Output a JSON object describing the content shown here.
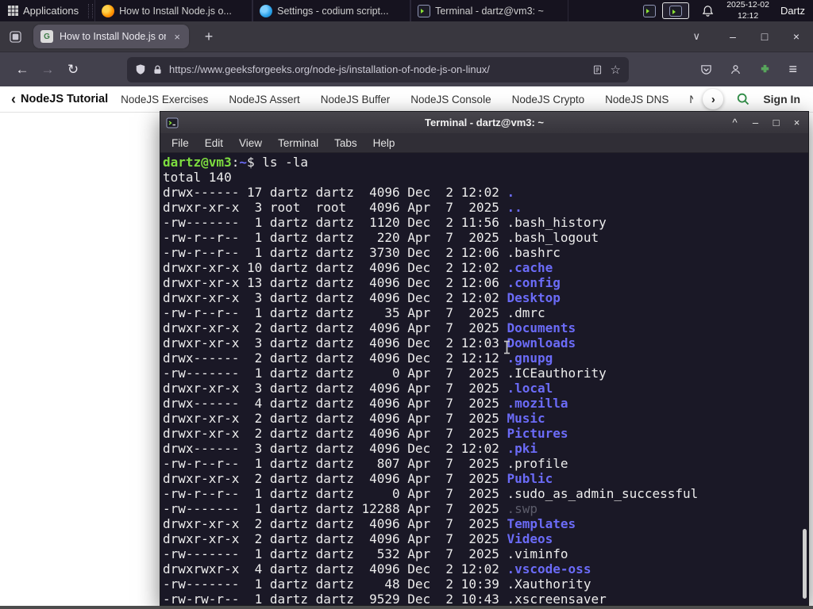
{
  "taskbar": {
    "applications_label": "Applications",
    "windows": [
      {
        "icon": "firefox",
        "label": "How to Install Node.js o..."
      },
      {
        "icon": "codium",
        "label": "Settings - codium script..."
      },
      {
        "icon": "terminal",
        "label": "Terminal - dartz@vm3: ~"
      }
    ],
    "clock_date": "2025-12-02",
    "clock_time": "12:12",
    "user_label": "Dartz"
  },
  "browser": {
    "tab_title": "How to Install Node.js on",
    "url": "https://www.geeksforgeeks.org/node-js/installation-of-node-js-on-linux/",
    "site_nav": {
      "title": "NodeJS Tutorial",
      "items": [
        "NodeJS Exercises",
        "NodeJS Assert",
        "NodeJS Buffer",
        "NodeJS Console",
        "NodeJS Crypto",
        "NodeJS DNS",
        "Node..."
      ],
      "sign_in_label": "Sign In"
    }
  },
  "terminal": {
    "title": "Terminal - dartz@vm3: ~",
    "menu": [
      "File",
      "Edit",
      "View",
      "Terminal",
      "Tabs",
      "Help"
    ],
    "prompt": {
      "user_host": "dartz@vm3",
      "colon": ":",
      "path": "~",
      "dollar": "$",
      "command": " ls -la"
    },
    "total_line": "total 140",
    "listing": [
      {
        "meta": "drwx------ 17 dartz dartz  4096 Dec  2 12:02 ",
        "name": ".",
        "type": "dir"
      },
      {
        "meta": "drwxr-xr-x  3 root  root   4096 Apr  7  2025 ",
        "name": "..",
        "type": "dir"
      },
      {
        "meta": "-rw-------  1 dartz dartz  1120 Dec  2 11:56 ",
        "name": ".bash_history",
        "type": "file"
      },
      {
        "meta": "-rw-r--r--  1 dartz dartz   220 Apr  7  2025 ",
        "name": ".bash_logout",
        "type": "file"
      },
      {
        "meta": "-rw-r--r--  1 dartz dartz  3730 Dec  2 12:06 ",
        "name": ".bashrc",
        "type": "file"
      },
      {
        "meta": "drwxr-xr-x 10 dartz dartz  4096 Dec  2 12:02 ",
        "name": ".cache",
        "type": "dir"
      },
      {
        "meta": "drwxr-xr-x 13 dartz dartz  4096 Dec  2 12:06 ",
        "name": ".config",
        "type": "dir"
      },
      {
        "meta": "drwxr-xr-x  3 dartz dartz  4096 Dec  2 12:02 ",
        "name": "Desktop",
        "type": "dir"
      },
      {
        "meta": "-rw-r--r--  1 dartz dartz    35 Apr  7  2025 ",
        "name": ".dmrc",
        "type": "file"
      },
      {
        "meta": "drwxr-xr-x  2 dartz dartz  4096 Apr  7  2025 ",
        "name": "Documents",
        "type": "dir"
      },
      {
        "meta": "drwxr-xr-x  3 dartz dartz  4096 Dec  2 12:03 ",
        "name": "Downloads",
        "type": "dir"
      },
      {
        "meta": "drwx------  2 dartz dartz  4096 Dec  2 12:12 ",
        "name": ".gnupg",
        "type": "dir"
      },
      {
        "meta": "-rw-------  1 dartz dartz     0 Apr  7  2025 ",
        "name": ".ICEauthority",
        "type": "file"
      },
      {
        "meta": "drwxr-xr-x  3 dartz dartz  4096 Apr  7  2025 ",
        "name": ".local",
        "type": "dir"
      },
      {
        "meta": "drwx------  4 dartz dartz  4096 Apr  7  2025 ",
        "name": ".mozilla",
        "type": "dir"
      },
      {
        "meta": "drwxr-xr-x  2 dartz dartz  4096 Apr  7  2025 ",
        "name": "Music",
        "type": "dir"
      },
      {
        "meta": "drwxr-xr-x  2 dartz dartz  4096 Apr  7  2025 ",
        "name": "Pictures",
        "type": "dir"
      },
      {
        "meta": "drwx------  3 dartz dartz  4096 Dec  2 12:02 ",
        "name": ".pki",
        "type": "dir"
      },
      {
        "meta": "-rw-r--r--  1 dartz dartz   807 Apr  7  2025 ",
        "name": ".profile",
        "type": "file"
      },
      {
        "meta": "drwxr-xr-x  2 dartz dartz  4096 Apr  7  2025 ",
        "name": "Public",
        "type": "dir"
      },
      {
        "meta": "-rw-r--r--  1 dartz dartz     0 Apr  7  2025 ",
        "name": ".sudo_as_admin_successful",
        "type": "file"
      },
      {
        "meta": "-rw-------  1 dartz dartz 12288 Apr  7  2025 ",
        "name": ".swp",
        "type": "dim"
      },
      {
        "meta": "drwxr-xr-x  2 dartz dartz  4096 Apr  7  2025 ",
        "name": "Templates",
        "type": "dir"
      },
      {
        "meta": "drwxr-xr-x  2 dartz dartz  4096 Apr  7  2025 ",
        "name": "Videos",
        "type": "dir"
      },
      {
        "meta": "-rw-------  1 dartz dartz   532 Apr  7  2025 ",
        "name": ".viminfo",
        "type": "file"
      },
      {
        "meta": "drwxrwxr-x  4 dartz dartz  4096 Dec  2 12:02 ",
        "name": ".vscode-oss",
        "type": "dir"
      },
      {
        "meta": "-rw-------  1 dartz dartz    48 Dec  2 10:39 ",
        "name": ".Xauthority",
        "type": "file"
      },
      {
        "meta": "-rw-rw-r--  1 dartz dartz  9529 Dec  2 10:43 ",
        "name": ".xscreensaver",
        "type": "file"
      }
    ]
  },
  "icons": {
    "back": "←",
    "forward": "→",
    "reload": "↻",
    "star": "☆",
    "menu": "≡",
    "new_tab": "+",
    "close": "×",
    "tabs_chevron": "∨",
    "minimize": "–",
    "maximize": "□",
    "shade": "^",
    "chevron_left": "‹",
    "chevron_right": "›"
  },
  "colors": {
    "gfg_green": "#2f8d46",
    "dir_blue": "#6b6bf7",
    "prompt_green": "#7ddc3f",
    "terminal_bg": "#1a1826",
    "firefox_orange": "#ff9500"
  }
}
